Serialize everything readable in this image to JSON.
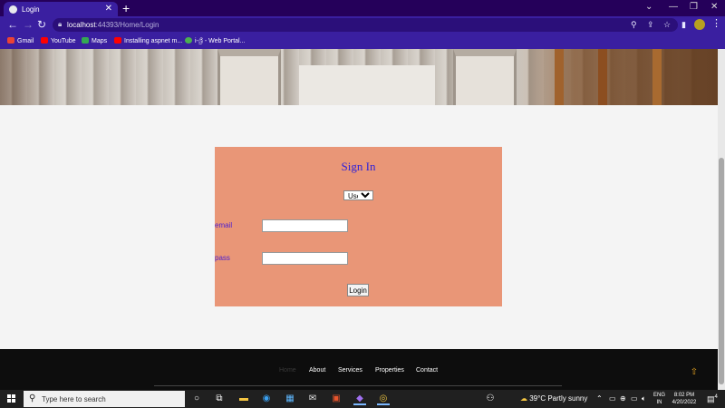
{
  "browser": {
    "tab_title": "Login",
    "new_tab": "+",
    "url_host": "localhost",
    "url_path": ":44393/Home/Login",
    "bookmarks": [
      {
        "label": "Gmail",
        "icon": "gmail-icon",
        "color": "#ea4335"
      },
      {
        "label": "YouTube",
        "icon": "youtube-icon",
        "color": "#ff0000"
      },
      {
        "label": "Maps",
        "icon": "maps-icon",
        "color": "#34a853"
      },
      {
        "label": "Installing aspnet m...",
        "icon": "youtube-icon",
        "color": "#ff0000"
      },
      {
        "label": "i-ශ්‍රී - Web Portal...",
        "icon": "globe-icon",
        "color": "#4caf50"
      }
    ]
  },
  "signin": {
    "title": "Sign In",
    "role_selected": "User",
    "email_label": "email",
    "email_value": "",
    "pass_label": "pass",
    "pass_value": "",
    "button_label": "Login"
  },
  "footer": {
    "nav": [
      {
        "label": "Home",
        "active": true
      },
      {
        "label": "About",
        "active": false
      },
      {
        "label": "Services",
        "active": false
      },
      {
        "label": "Properties",
        "active": false
      },
      {
        "label": "Contact",
        "active": false
      }
    ]
  },
  "taskbar": {
    "search_placeholder": "Type here to search",
    "weather": "39°C  Partly sunny",
    "lang_line1": "ENG",
    "lang_line2": "IN",
    "time": "8:02 PM",
    "date": "4/20/2022",
    "notifications": "4"
  },
  "colors": {
    "browser_frame": "#3a1fa0",
    "signin_panel": "#e99677",
    "signin_title": "#2f22d8",
    "footer_bg": "#0d0d0d"
  }
}
